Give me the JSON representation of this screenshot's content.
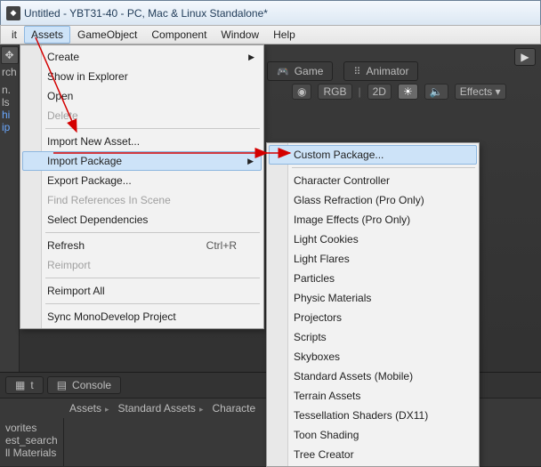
{
  "window": {
    "title": "Untitled - YBT31-40 - PC, Mac & Linux Standalone*"
  },
  "menubar": {
    "items": [
      "it",
      "Assets",
      "GameObject",
      "Component",
      "Window",
      "Help"
    ],
    "open_index": 1
  },
  "assets_menu": {
    "create": "Create",
    "show_in_explorer": "Show in Explorer",
    "open": "Open",
    "delete": "Delete",
    "import_new_asset": "Import New Asset...",
    "import_package": "Import Package",
    "export_package": "Export Package...",
    "find_references": "Find References In Scene",
    "select_dependencies": "Select Dependencies",
    "refresh": "Refresh",
    "refresh_shortcut": "Ctrl+R",
    "reimport": "Reimport",
    "reimport_all": "Reimport All",
    "sync_mono": "Sync MonoDevelop Project"
  },
  "import_submenu": {
    "custom_package": "Custom Package...",
    "character_controller": "Character Controller",
    "glass_refraction": "Glass Refraction (Pro Only)",
    "image_effects": "Image Effects (Pro Only)",
    "light_cookies": "Light Cookies",
    "light_flares": "Light Flares",
    "particles": "Particles",
    "physic_materials": "Physic Materials",
    "projectors": "Projectors",
    "scripts": "Scripts",
    "skyboxes": "Skyboxes",
    "standard_assets_mobile": "Standard Assets (Mobile)",
    "terrain_assets": "Terrain Assets",
    "tessellation_shaders": "Tessellation Shaders (DX11)",
    "toon_shading": "Toon Shading",
    "tree_creator": "Tree Creator"
  },
  "toolbar": {
    "game_tab": "Game",
    "animator_tab": "Animator",
    "rgb": "RGB",
    "mode_2d": "2D",
    "effects": "Effects"
  },
  "bottom": {
    "project_tab": "t",
    "console_tab": "Console",
    "favorites": "vorites",
    "crumb1": "Assets",
    "crumb2": "Standard Assets",
    "crumb3": "Characte",
    "fav1": "est_search",
    "fav2": "ll Materials"
  },
  "left": {
    "l1": "rch",
    "l2": "n.",
    "l3": "ls",
    "l4": "hi",
    "l5": "ip"
  }
}
